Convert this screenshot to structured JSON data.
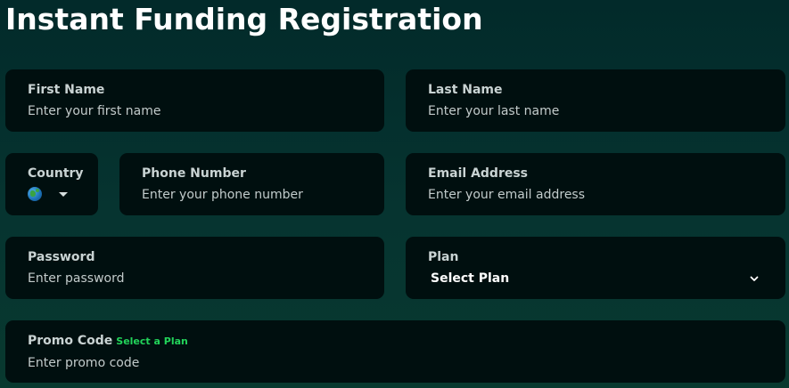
{
  "page": {
    "title": "Instant Funding Registration"
  },
  "form": {
    "first_name": {
      "label": "First Name",
      "placeholder": "Enter your first name"
    },
    "last_name": {
      "label": "Last Name",
      "placeholder": "Enter your last name"
    },
    "country": {
      "label": "Country",
      "flag_icon": "globe-icon"
    },
    "phone": {
      "label": "Phone Number",
      "placeholder": "Enter your phone number"
    },
    "email": {
      "label": "Email Address",
      "placeholder": "Enter your email address"
    },
    "password": {
      "label": "Password",
      "placeholder": "Enter password"
    },
    "plan": {
      "label": "Plan",
      "selected": "Select Plan"
    },
    "promo": {
      "label": "Promo Code",
      "hint": "Select a Plan",
      "placeholder": "Enter promo code"
    }
  },
  "colors": {
    "background_top": "#022a2a",
    "field_background": "#000f0f",
    "hint_green": "#22d35a"
  }
}
